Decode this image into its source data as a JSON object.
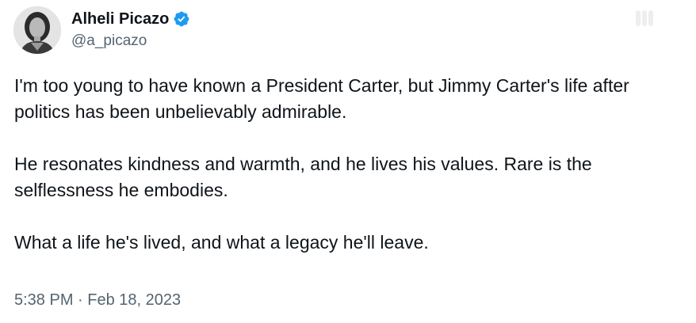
{
  "author": {
    "display_name": "Alheli Picazo",
    "handle": "@a_picazo",
    "verified_icon": "verified-badge-icon",
    "verified_color": "#1d9bf0"
  },
  "tweet": {
    "paragraphs": [
      "I'm too young to have known a President Carter, but Jimmy Carter's life after politics has been unbelievably admirable.",
      "He resonates kindness and warmth, and he lives his values. Rare is the selflessness he embodies.",
      "What a life he's lived, and what a legacy he'll leave."
    ],
    "timestamp": "5:38 PM · Feb 18, 2023"
  },
  "colors": {
    "text_primary": "#0f1419",
    "text_secondary": "#536471",
    "accent": "#1d9bf0"
  }
}
